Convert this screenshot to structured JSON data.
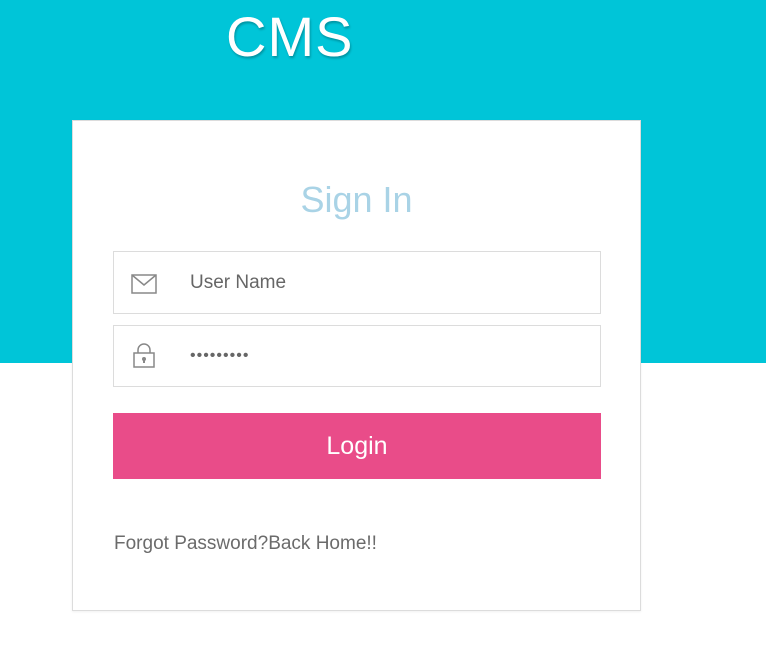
{
  "header": {
    "title": "CMS",
    "background_color": "#00c5d8"
  },
  "login_card": {
    "title": "Sign In",
    "username": {
      "icon": "envelope-icon",
      "placeholder": "User Name",
      "value": ""
    },
    "password": {
      "icon": "lock-icon",
      "value": "•••••••••"
    },
    "login_button": {
      "label": "Login",
      "color": "#e94c89"
    },
    "links": {
      "forgot_password": "Forgot Password?",
      "back_home": "Back Home!!"
    }
  }
}
